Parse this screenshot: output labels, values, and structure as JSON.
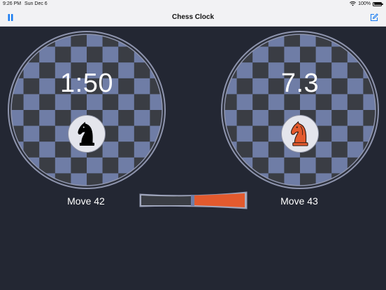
{
  "status_bar": {
    "time": "9:26 PM",
    "date": "Sun Dec 6",
    "battery": "100%",
    "wifi_icon": "wifi-icon",
    "battery_icon": "battery-icon"
  },
  "nav": {
    "title": "Chess Clock",
    "left_icon": "pause-icon",
    "right_icon": "edit-icon",
    "accent": "#1a7cf2"
  },
  "players": {
    "left": {
      "time": "1:50",
      "move": "Move 42",
      "piece": "knight",
      "piece_color": "#000000"
    },
    "right": {
      "time": "7.3",
      "move": "Move 43",
      "piece": "knight",
      "piece_color": "#e35a2e"
    }
  },
  "board_colors": {
    "dark": "#3a3d44",
    "light": "#6f7da6",
    "ring": "#8e94ad"
  },
  "time_ratio": {
    "left_fraction": 0.48,
    "left_color": "#3a3d44",
    "right_color": "#e35a2e",
    "divider_color": "#6f7da6"
  }
}
